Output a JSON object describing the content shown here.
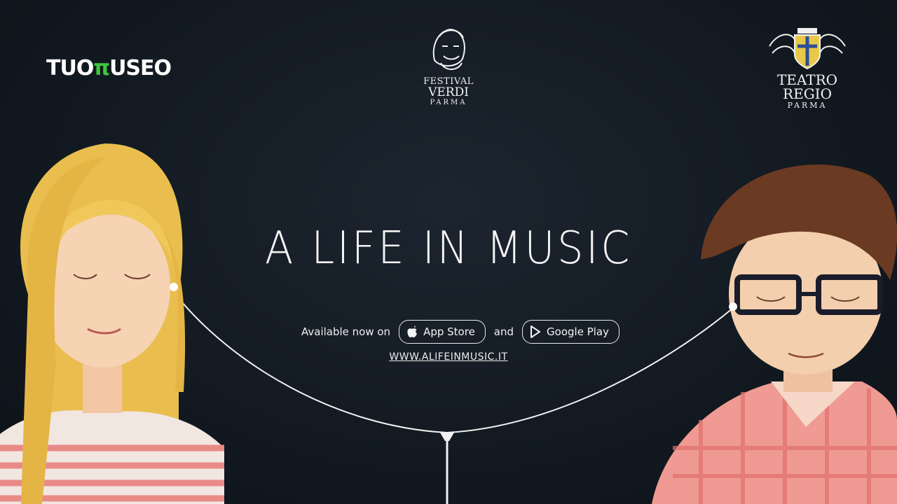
{
  "logos": {
    "left": {
      "part1": "TUO",
      "part2": "π",
      "part3": "USEO"
    },
    "center": {
      "line1": "FESTIVAL",
      "line2": "VERDI",
      "line3": "PARMA"
    },
    "right": {
      "line1": "TEATRO",
      "line2": "REGIO",
      "line3": "PARMA"
    }
  },
  "title": "A LIFE IN MUSIC",
  "availability": {
    "prefix": "Available now on",
    "app_store": "App Store",
    "conjunction": "and",
    "google_play": "Google Play"
  },
  "url": "WWW.ALIFEINMUSIC.IT",
  "icons": [
    "apple-icon",
    "google-play-icon"
  ],
  "colors": {
    "background": "#131a22",
    "accent_green": "#3cc93c",
    "text": "#f4f4f4"
  }
}
